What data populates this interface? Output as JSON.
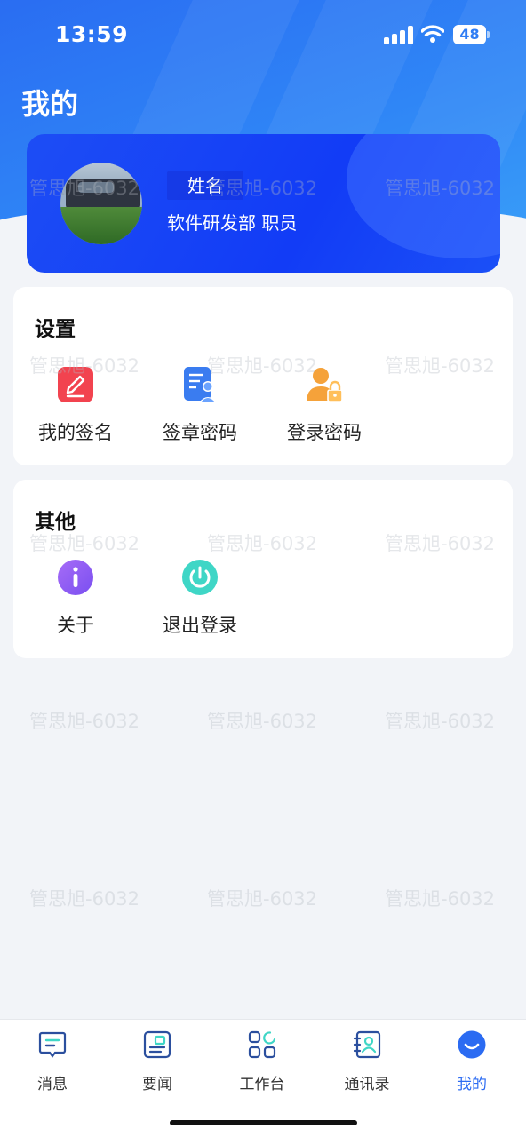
{
  "status_bar": {
    "time": "13:59",
    "battery": "48"
  },
  "page": {
    "title": "我的"
  },
  "profile": {
    "name": "姓名",
    "department": "软件研发部 职员"
  },
  "settings": {
    "title": "设置",
    "items": [
      {
        "label": "我的签名",
        "icon": "signature-edit-icon"
      },
      {
        "label": "签章密码",
        "icon": "seal-document-icon"
      },
      {
        "label": "登录密码",
        "icon": "user-lock-icon"
      }
    ]
  },
  "other": {
    "title": "其他",
    "items": [
      {
        "label": "关于",
        "icon": "info-icon"
      },
      {
        "label": "退出登录",
        "icon": "power-icon"
      }
    ]
  },
  "tabs": [
    {
      "label": "消息",
      "icon": "message-icon",
      "active": false
    },
    {
      "label": "要闻",
      "icon": "news-icon",
      "active": false
    },
    {
      "label": "工作台",
      "icon": "workbench-grid-icon",
      "active": false
    },
    {
      "label": "通讯录",
      "icon": "contacts-book-icon",
      "active": false
    },
    {
      "label": "我的",
      "icon": "smile-profile-icon",
      "active": true
    }
  ],
  "watermark": {
    "text": "管思旭-6032"
  },
  "colors": {
    "accent": "#2b6bf2",
    "header_blue": "#2f7df4",
    "card_blue": "#1443f5",
    "signature_red": "#f2434f",
    "seal_blue": "#3a7cf0",
    "lock_orange": "#f5a23a",
    "info_purple": "#8a5cf0",
    "power_teal": "#3fd6c6"
  }
}
